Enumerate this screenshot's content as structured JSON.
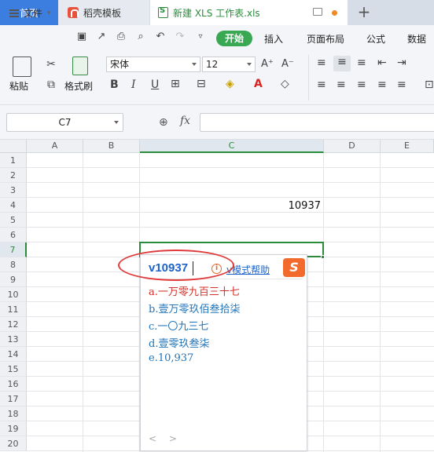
{
  "tabs": {
    "home": "首页",
    "shell": "稻壳模板",
    "doc": "新建 XLS 工作表.xls"
  },
  "menu": {
    "file": "文件",
    "start": "开始",
    "insert": "插入",
    "layout": "页面布局",
    "formula": "公式",
    "data": "数据"
  },
  "ribbon": {
    "paste": "粘贴",
    "format_painter": "格式刷",
    "font_name": "宋体",
    "font_size": "12"
  },
  "formula_bar": {
    "cell_ref": "C7",
    "fx": "fx",
    "content": ""
  },
  "columns": [
    "A",
    "B",
    "C",
    "D",
    "E"
  ],
  "rows": [
    "1",
    "2",
    "3",
    "4",
    "5",
    "6",
    "7",
    "8",
    "9",
    "10",
    "11",
    "12",
    "13",
    "14",
    "15",
    "16",
    "17",
    "18",
    "19",
    "20"
  ],
  "cells": {
    "C4": "10937"
  },
  "ime": {
    "input": "v10937",
    "help": "v模式帮助",
    "logo": "S",
    "nav": "< >",
    "candidates": [
      "a.一万零九百三十七",
      "b.壹万零玖佰叁拾柒",
      "c.一〇九三七",
      "d.壹零玖叁柒",
      "e.10,937"
    ]
  },
  "colors": {
    "accent_green": "#2a8c3b",
    "ime_blue": "#1d63c9",
    "annotation_red": "#e03a3a"
  }
}
